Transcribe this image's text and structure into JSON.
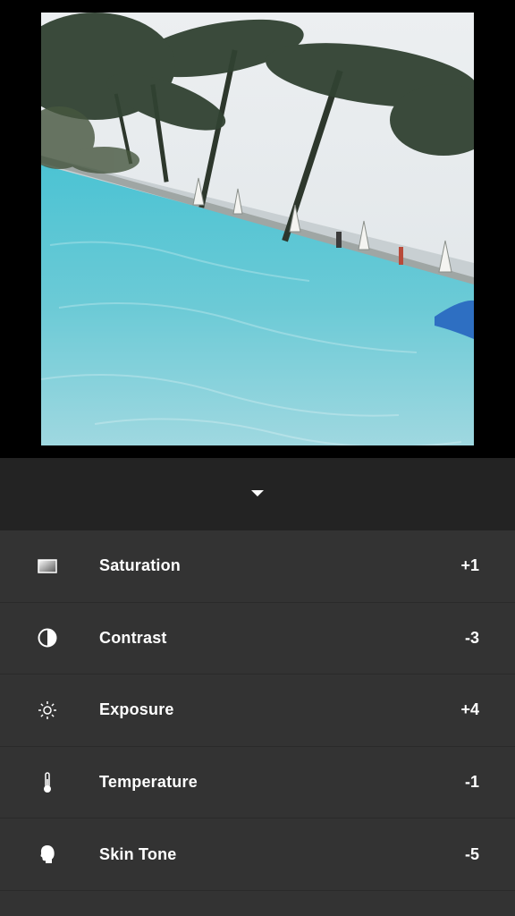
{
  "preview": {
    "subject": "photo",
    "colors": {
      "water": "#6fc9d6",
      "sky": "#e8eaec",
      "palm": "#2f3b2c"
    }
  },
  "panel": {
    "collapse_icon": "chevron-down-icon"
  },
  "adjustments": [
    {
      "label": "Saturation",
      "value": "+1",
      "icon": "saturation-icon"
    },
    {
      "label": "Contrast",
      "value": "-3",
      "icon": "contrast-icon"
    },
    {
      "label": "Exposure",
      "value": "+4",
      "icon": "exposure-icon"
    },
    {
      "label": "Temperature",
      "value": "-1",
      "icon": "temperature-icon"
    },
    {
      "label": "Skin Tone",
      "value": "-5",
      "icon": "skin-tone-icon"
    }
  ]
}
